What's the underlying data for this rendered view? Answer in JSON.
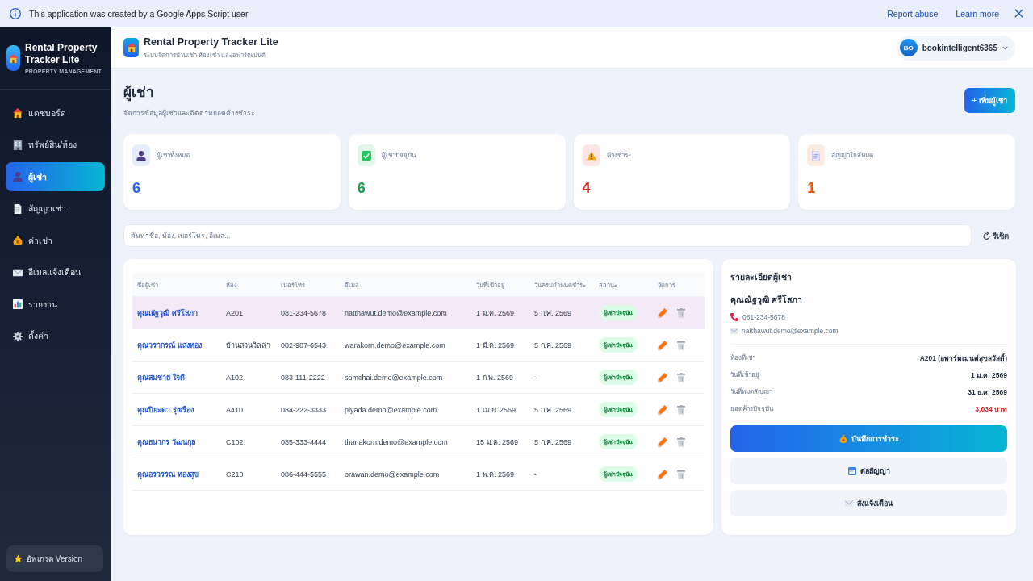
{
  "notice_bar": {
    "message": "This application was created by a Google Apps Script user",
    "links": [
      "Report abuse",
      "Learn more"
    ]
  },
  "sidebar": {
    "brand_name": "Rental Property Tracker Lite",
    "brand_tagline": "PROPERTY MANAGEMENT",
    "items": [
      {
        "label": "แดชบอร์ด",
        "selected": false
      },
      {
        "label": "ทรัพย์สิน/ห้อง",
        "selected": false
      },
      {
        "label": "ผู้เช่า",
        "selected": true
      },
      {
        "label": "สัญญาเช่า",
        "selected": false
      },
      {
        "label": "ค่าเช่า",
        "selected": false
      },
      {
        "label": "อีเมลแจ้งเตือน",
        "selected": false
      },
      {
        "label": "รายงาน",
        "selected": false
      },
      {
        "label": "ตั้งค่า",
        "selected": false
      }
    ],
    "upgrade_button": "อัพเกรด Version"
  },
  "header": {
    "title": "Rental Property Tracker Lite",
    "subtitle": "ระบบจัดการบ้านเช่า ห้องเช่า และอพาร์ตเมนต์",
    "user": {
      "initials": "BO",
      "name": "bookintelligent6365"
    }
  },
  "page": {
    "title": "ผู้เช่า",
    "subtitle": "จัดการข้อมูลผู้เช่าและติดตามยอดค้างชำระ",
    "add_button": "+ เพิ่มผู้เช่า"
  },
  "stats": [
    {
      "label": "ผู้เช่าทั้งหมด",
      "value": "6",
      "color": "#2563eb"
    },
    {
      "label": "ผู้เช่าปัจจุบัน",
      "value": "6",
      "color": "#16a34a"
    },
    {
      "label": "ค้างชำระ",
      "value": "4",
      "color": "#dc2626"
    },
    {
      "label": "สัญญาใกล้หมด",
      "value": "1",
      "color": "#ea580c"
    }
  ],
  "search": {
    "placeholder": "ค้นหาชื่อ, ห้อง, เบอร์โทร, อีเมล...",
    "reset_button": "รีเซ็ต"
  },
  "table": {
    "columns": [
      "ชื่อผู้เช่า",
      "ห้อง",
      "เบอร์โทร",
      "อีเมล",
      "วันที่เข้าอยู่",
      "วันครบกำหนดชำระ",
      "สถานะ",
      "จัดการ"
    ],
    "rows": [
      {
        "name": "คุณณัฐวุฒิ ศรีโสภา",
        "room": "A201",
        "phone": "081-234-5678",
        "email": "natthawut.demo@example.com",
        "move_in": "1 ม.ค. 2569",
        "due": "5 ก.ค. 2569",
        "status": "ผู้เช่าปัจจุบัน",
        "selected": true
      },
      {
        "name": "คุณวรากรณ์ แสงทอง",
        "room": "บ้านสวนวิลล่า",
        "phone": "082-987-6543",
        "email": "warakorn.demo@example.com",
        "move_in": "1 มี.ค. 2569",
        "due": "5 ก.ค. 2569",
        "status": "ผู้เช่าปัจจุบัน",
        "selected": false
      },
      {
        "name": "คุณสมชาย ใจดี",
        "room": "A102",
        "phone": "083-111-2222",
        "email": "somchai.demo@example.com",
        "move_in": "1 ก.พ. 2569",
        "due": "-",
        "status": "ผู้เช่าปัจจุบัน",
        "selected": false
      },
      {
        "name": "คุณปิยะดา รุ่งเรือง",
        "room": "A410",
        "phone": "084-222-3333",
        "email": "piyada.demo@example.com",
        "move_in": "1 เม.ย. 2569",
        "due": "5 ก.ค. 2569",
        "status": "ผู้เช่าปัจจุบัน",
        "selected": false
      },
      {
        "name": "คุณธนากร วัฒนกุล",
        "room": "C102",
        "phone": "085-333-4444",
        "email": "thanakorn.demo@example.com",
        "move_in": "15 ม.ค. 2569",
        "due": "5 ก.ค. 2569",
        "status": "ผู้เช่าปัจจุบัน",
        "selected": false
      },
      {
        "name": "คุณอรวรรณ ทองสุข",
        "room": "C210",
        "phone": "086-444-5555",
        "email": "orawan.demo@example.com",
        "move_in": "1 พ.ค. 2569",
        "due": "-",
        "status": "ผู้เช่าปัจจุบัน",
        "selected": false
      }
    ]
  },
  "detail": {
    "title": "รายละเอียดผู้เช่า",
    "name": "คุณณัฐวุฒิ ศรีโสภา",
    "phone": "081-234-5678",
    "email": "natthawut.demo@example.com",
    "fields": [
      {
        "label": "ห้องที่เช่า",
        "value": "A201 (อพาร์ตเมนต์สุขสวัสดิ์)",
        "kind": "normal"
      },
      {
        "label": "วันที่เข้าอยู่",
        "value": "1 ม.ค. 2569",
        "kind": "normal"
      },
      {
        "label": "วันที่หมดสัญญา",
        "value": "31 ธ.ค. 2569",
        "kind": "normal"
      },
      {
        "label": "ยอดค้างปัจจุบัน",
        "value": "3,034 บาท",
        "kind": "overdue"
      }
    ],
    "actions": [
      {
        "label": "บันทึกการชำระ",
        "kind": "primary"
      },
      {
        "label": "ต่อสัญญา",
        "kind": "secondary"
      },
      {
        "label": "ส่งแจ้งเตือน",
        "kind": "secondary"
      }
    ]
  }
}
